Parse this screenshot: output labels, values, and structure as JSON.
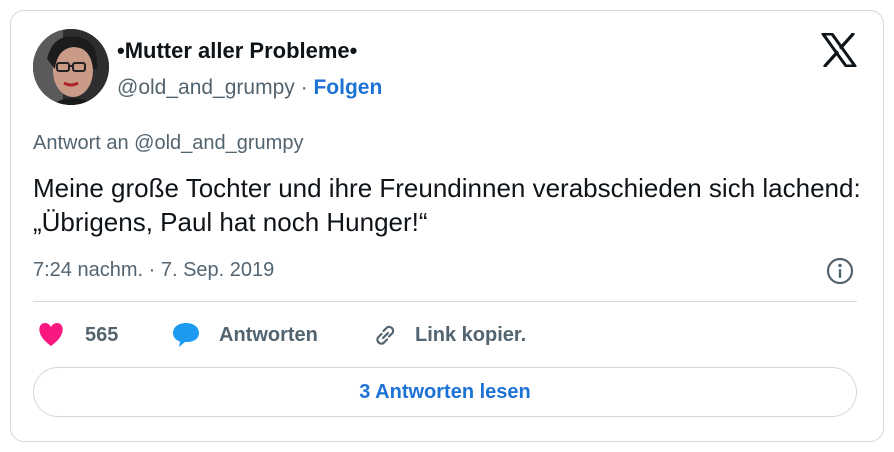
{
  "author": {
    "display_name": "•Mutter aller Probleme•",
    "handle": "@old_and_grumpy",
    "separator": "·",
    "follow_label": "Folgen"
  },
  "tweet": {
    "reply_to": "Antwort an @old_and_grumpy",
    "text": "Meine große Tochter und ihre Freundinnen verabschieden sich lachend: „Übrigens, Paul hat noch Hunger!“",
    "timestamp": "7:24 nachm. · 7. Sep. 2019"
  },
  "actions": {
    "like_count": "565",
    "reply_label": "Antworten",
    "copy_link_label": "Link kopier."
  },
  "read_replies_label": "3 Antworten lesen",
  "colors": {
    "accent": "#1d72d6",
    "like": "#f91880",
    "reply_icon": "#1d9bf0",
    "secondary_text": "#536471",
    "border": "#cfd9de"
  },
  "icons": [
    "avatar-photo",
    "x-logo-icon",
    "info-icon",
    "heart-icon",
    "speech-bubble-icon",
    "link-icon"
  ]
}
